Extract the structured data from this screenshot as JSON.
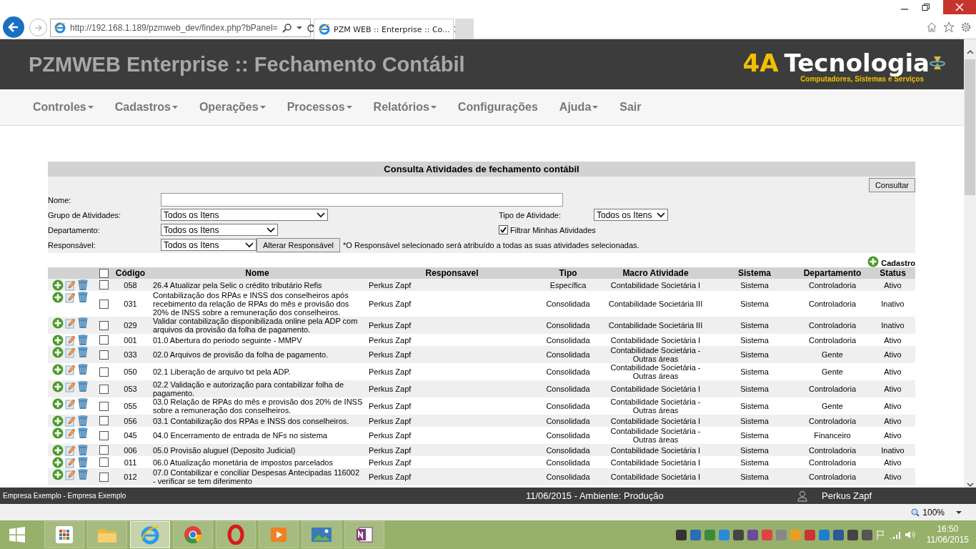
{
  "browser": {
    "address": "http://192.168.1.189/pzmweb_dev/findex.php?bPanel=",
    "tab_title": "PZM WEB :: Enterprise :: Co..."
  },
  "header": {
    "title": "PZMWEB Enterprise :: Fechamento Contábil",
    "logo_mark": "4A",
    "logo_word": "Tecnologia",
    "logo_tagline": "Computadores, Sistemas e Serviços"
  },
  "menu": [
    {
      "label": "Controles",
      "dropdown": true
    },
    {
      "label": "Cadastros",
      "dropdown": true
    },
    {
      "label": "Operações",
      "dropdown": true
    },
    {
      "label": "Processos",
      "dropdown": true
    },
    {
      "label": "Relatórios",
      "dropdown": true
    },
    {
      "label": "Configurações",
      "dropdown": false
    },
    {
      "label": "Ajuda",
      "dropdown": true
    },
    {
      "label": "Sair",
      "dropdown": false
    }
  ],
  "search": {
    "title": "Consulta Atividades de fechamento contábil",
    "submit": "Consultar",
    "name_label": "Nome:",
    "group_label": "Grupo de Atividades:",
    "group_value": "Todos os Itens",
    "type_label": "Tipo de Atividade:",
    "type_value": "Todos os Itens",
    "dept_label": "Departamento:",
    "dept_value": "Todos os Itens",
    "filter_label": "Filtrar Minhas Atividades",
    "filter_checked": true,
    "resp_label": "Responsável:",
    "resp_value": "Todos os Itens",
    "change_button": "Alterar Responsável",
    "note": "*O Responsável selecionado será atribuído a todas as suas atividades selecionadas."
  },
  "add_link": "Cadastro",
  "table": {
    "select_all": false,
    "columns": [
      "Código",
      "Nome",
      "Responsavel",
      "Tipo",
      "Macro Atividade",
      "Sistema",
      "Departamento",
      "Status"
    ],
    "rows": [
      {
        "selected": false,
        "cells": [
          "058",
          "26.4 Atualizar pela Selic o crédito tributário Refis",
          "Perkus Zapf",
          "Específica",
          "Contabilidade Societária I",
          "Sistema",
          "Controladoria",
          "Ativo"
        ]
      },
      {
        "selected": false,
        "cells": [
          "031",
          "Contabilização dos RPAs e INSS dos conselheiros após recebimento da relação de RPAs do mês e provisão dos 20% de INSS sobre a remuneração dos conselheiros.",
          "Perkus Zapf",
          "Consolidada",
          "Contabilidade Societária III",
          "Sistema",
          "Controladoria",
          "Inativo"
        ]
      },
      {
        "selected": false,
        "cells": [
          "029",
          "Validar contabilização disponibilizada online pela ADP com arquivos da provisão da folha de pagamento.",
          "Perkus Zapf",
          "Consolidada",
          "Contabilidade Societária III",
          "Sistema",
          "Controladoria",
          "Inativo"
        ]
      },
      {
        "selected": false,
        "cells": [
          "001",
          "01.0 Abertura do periodo seguinte - MMPV",
          "Perkus Zapf",
          "Consolidada",
          "Contabilidade Societária I",
          "Sistema",
          "Controladoria",
          "Ativo"
        ]
      },
      {
        "selected": false,
        "cells": [
          "033",
          "02.0 Arquivos de provisão da folha de pagamento.",
          "Perkus Zapf",
          "Consolidada",
          "Contabilidade Societária - Outras áreas",
          "Sistema",
          "Gente",
          "Ativo"
        ]
      },
      {
        "selected": false,
        "cells": [
          "050",
          "02.1 Liberação de arquivo txt pela ADP.",
          "Perkus Zapf",
          "Consolidada",
          "Contabilidade Societária - Outras áreas",
          "Sistema",
          "Gente",
          "Ativo"
        ]
      },
      {
        "selected": false,
        "cells": [
          "053",
          "02.2 Validação e autorização para contabilizar folha de pagamento.",
          "Perkus Zapf",
          "Consolidada",
          "Contabilidade Societária I",
          "Sistema",
          "Controladoria",
          "Ativo"
        ]
      },
      {
        "selected": false,
        "cells": [
          "055",
          "03.0 Relação de RPAs do mês e provisão dos 20% de INSS sobre a remuneração dos conselheiros.",
          "Perkus Zapf",
          "Consolidada",
          "Contabilidade Societária - Outras áreas",
          "Sistema",
          "Gente",
          "Ativo"
        ]
      },
      {
        "selected": false,
        "cells": [
          "056",
          "03.1 Contabilização dos RPAs e INSS dos conselheiros.",
          "Perkus Zapf",
          "Consolidada",
          "Contabilidade Societária I",
          "Sistema",
          "Controladoria",
          "Ativo"
        ]
      },
      {
        "selected": false,
        "cells": [
          "045",
          "04.0 Encerramento de entrada de NFs no sistema",
          "Perkus Zapf",
          "Consolidada",
          "Contabilidade Societária - Outras áreas",
          "Sistema",
          "Financeiro",
          "Ativo"
        ]
      },
      {
        "selected": false,
        "cells": [
          "006",
          "05.0 Provisão aluguel (Deposito Judicial)",
          "Perkus Zapf",
          "Consolidada",
          "Contabilidade Societária I",
          "Sistema",
          "Controladoria",
          "Inativo"
        ]
      },
      {
        "selected": false,
        "cells": [
          "011",
          "06.0 Atualização monetária de impostos parcelados",
          "Perkus Zapf",
          "Consolidada",
          "Contabilidade Societária I",
          "Sistema",
          "Controladoria",
          "Ativo"
        ]
      },
      {
        "selected": false,
        "cells": [
          "012",
          "07.0 Contabilizar e conciliar Despesas Antecipadas 116002 - verificar se tem diferimento",
          "Perkus Zapf",
          "Consolidada",
          "Contabilidade Societária I",
          "Sistema",
          "Controladoria",
          "Ativo"
        ]
      }
    ]
  },
  "status_bar": {
    "company": "Empresa Exemplo - Empresa Exemplo",
    "date_env": "11/06/2015 - Ambiente: Produção",
    "user": "Perkus Zapf"
  },
  "zoom": "100%",
  "taskbar": {
    "apps": [
      {
        "kind": "tiles",
        "active": false
      },
      {
        "kind": "folder",
        "active": false
      },
      {
        "kind": "ie",
        "active": true
      },
      {
        "kind": "chrome",
        "active": false
      },
      {
        "kind": "opera",
        "active": false
      },
      {
        "kind": "player",
        "active": false
      },
      {
        "kind": "photo",
        "active": false
      },
      {
        "kind": "onenote",
        "active": false
      }
    ],
    "time": "16:50",
    "date": "11/06/2015"
  }
}
